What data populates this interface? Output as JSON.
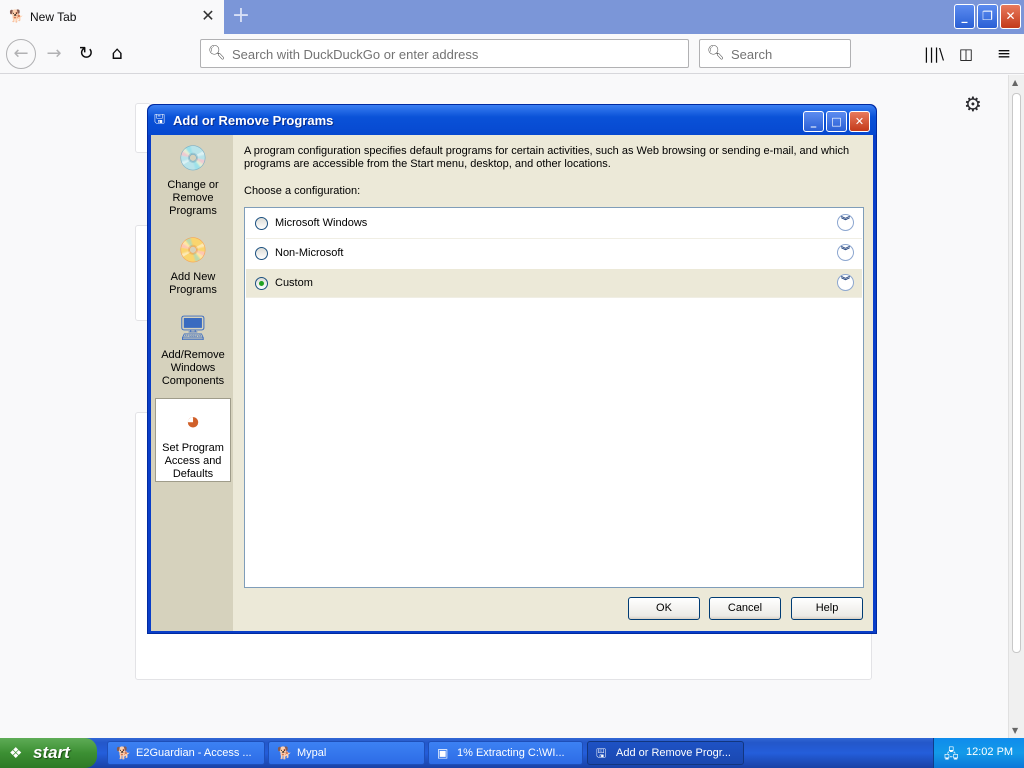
{
  "browser": {
    "tab_title": "New Tab",
    "tab_close": "✕",
    "new_tab": "+",
    "url_placeholder": "Search with DuckDuckGo or enter address",
    "search_placeholder": "Search"
  },
  "dialog": {
    "title": "Add or Remove Programs",
    "left_nav": [
      {
        "label": "Change or Remove Programs"
      },
      {
        "label": "Add New Programs"
      },
      {
        "label": "Add/Remove Windows Components"
      },
      {
        "label": "Set Program Access and Defaults"
      }
    ],
    "description": "A program configuration specifies default programs for certain activities, such as Web browsing or sending e-mail, and which programs are accessible from the Start menu, desktop, and other locations.",
    "choose_label": "Choose a configuration:",
    "configurations": [
      {
        "label": "Microsoft Windows",
        "selected": false
      },
      {
        "label": "Non-Microsoft",
        "selected": false
      },
      {
        "label": "Custom",
        "selected": true
      }
    ],
    "buttons": {
      "ok": "OK",
      "cancel": "Cancel",
      "help": "Help"
    }
  },
  "taskbar": {
    "start": "start",
    "tasks": [
      {
        "label": "E2Guardian - Access ..."
      },
      {
        "label": "Mypal"
      },
      {
        "label": "1% Extracting C:\\WI..."
      },
      {
        "label": "Add or Remove Progr..."
      }
    ],
    "clock": "12:02 PM"
  },
  "colors": {
    "xp_title_blue": "#0a52d8",
    "dialog_face": "#ece9d8",
    "start_green": "#3c8f33",
    "taskbar_blue": "#245edb"
  }
}
